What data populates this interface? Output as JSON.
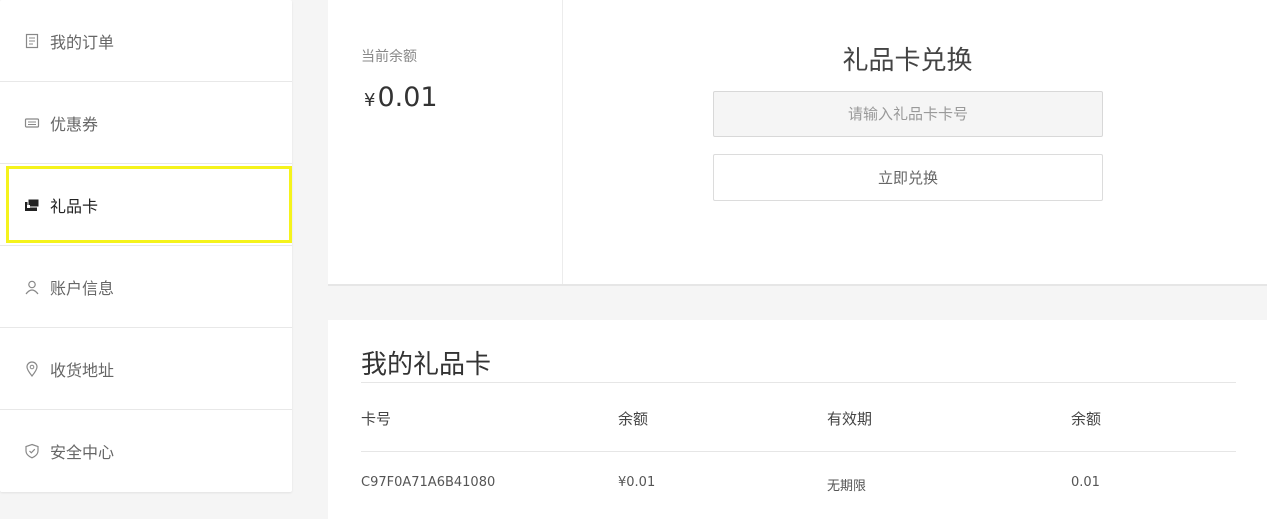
{
  "sidebar": {
    "items": [
      {
        "label": "我的订单",
        "icon": "document-icon"
      },
      {
        "label": "优惠券",
        "icon": "coupon-icon"
      },
      {
        "label": "礼品卡",
        "icon": "gift-card-icon",
        "active": true
      },
      {
        "label": "账户信息",
        "icon": "user-icon"
      },
      {
        "label": "收货地址",
        "icon": "location-icon"
      },
      {
        "label": "安全中心",
        "icon": "shield-icon"
      }
    ]
  },
  "balance": {
    "label": "当前余额",
    "currency": "¥",
    "amount": "0.01"
  },
  "redeem": {
    "title": "礼品卡兑换",
    "input_placeholder": "请输入礼品卡卡号",
    "button_label": "立即兑换"
  },
  "my_cards": {
    "title": "我的礼品卡",
    "columns": [
      "卡号",
      "余额",
      "有效期",
      "余额"
    ],
    "rows": [
      [
        "C97F0A71A6B41080",
        "¥0.01",
        "无期限",
        "0.01"
      ]
    ]
  },
  "colors": {
    "active_highlight": "#f5f31c"
  }
}
